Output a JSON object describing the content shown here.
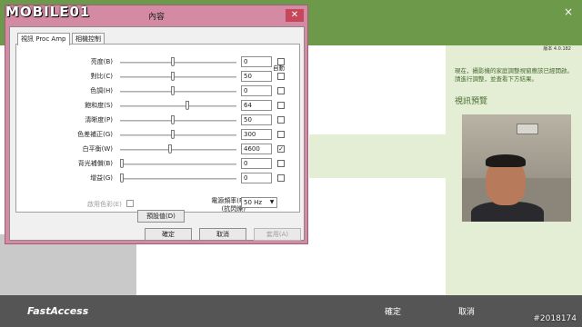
{
  "watermark": {
    "top": "MOBILE01",
    "bottom": "#2018174"
  },
  "app": {
    "close_glyph": "×",
    "version": "版本 4.0.182",
    "description": "現在，攝影機的家庭調整視窗應該已經開啟。請進行調整，並查看下方結果。",
    "preview_title": "視訊預覽",
    "brand": "FastAccess",
    "ok_label": "確定",
    "cancel_label": "取消",
    "colors": {
      "topbar": "#6d9a4a",
      "panel": "#e3eed5",
      "bottom": "#555555"
    }
  },
  "dialog": {
    "title": "內容",
    "close_glyph": "✕",
    "tabs": [
      {
        "label": "視訊 Proc Amp",
        "active": true
      },
      {
        "label": "相機控制",
        "active": false
      }
    ],
    "auto_header": "自動",
    "rows": [
      {
        "label": "亮度(B)",
        "value": "0",
        "level": 0.45,
        "auto": false,
        "disabled": false
      },
      {
        "label": "對比(C)",
        "value": "50",
        "level": 0.45,
        "auto": false,
        "disabled": false
      },
      {
        "label": "色調(H)",
        "value": "0",
        "level": 0.45,
        "auto": false,
        "disabled": false
      },
      {
        "label": "飽和度(S)",
        "value": "64",
        "level": 0.58,
        "auto": false,
        "disabled": false
      },
      {
        "label": "清晰度(P)",
        "value": "50",
        "level": 0.45,
        "auto": false,
        "disabled": false
      },
      {
        "label": "色差補正(G)",
        "value": "300",
        "level": 0.45,
        "auto": false,
        "disabled": false
      },
      {
        "label": "白平衡(W)",
        "value": "4600",
        "level": 0.43,
        "auto": true,
        "disabled": false
      },
      {
        "label": "背光補償(B)",
        "value": "0",
        "level": 0.0,
        "auto": false,
        "disabled": false
      },
      {
        "label": "增益(G)",
        "value": "0",
        "level": 0.0,
        "auto": false,
        "disabled": false
      }
    ],
    "color_enable_label": "啟用色彩(E)",
    "freq_label_1": "電源頻率(P)",
    "freq_label_2": "(抗閃爍)",
    "freq_value": "50 Hz",
    "default_button": "預設值(D)",
    "ok_button": "確定",
    "cancel_button": "取消",
    "apply_button": "套用(A)"
  }
}
